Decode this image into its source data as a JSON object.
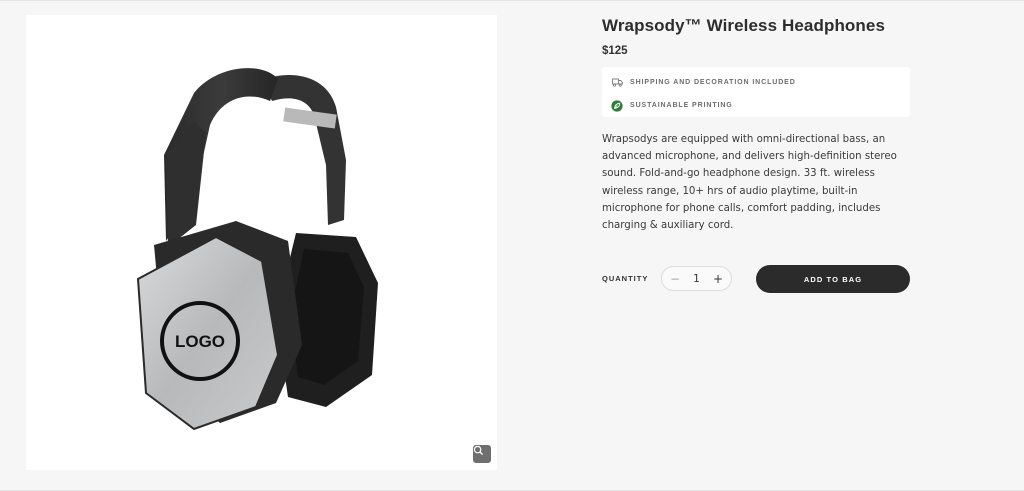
{
  "product": {
    "title": "Wrapsody™ Wireless Headphones",
    "price": "$125",
    "image_logo_text": "LOGO",
    "description": "Wrapsodys are equipped with omni-directional bass, an advanced microphone, and delivers high-definition stereo sound. Fold-and-go headphone design. 33 ft. wireless wireless range, 10+ hrs of audio playtime, built-in microphone for phone calls, comfort padding, includes charging & auxiliary cord."
  },
  "info": {
    "shipping": {
      "label": "SHIPPING AND DECORATION INCLUDED",
      "icon": "truck-icon"
    },
    "sustainable": {
      "label": "SUSTAINABLE PRINTING",
      "icon": "leaf-icon",
      "icon_color": "#2e7d3a"
    }
  },
  "purchase": {
    "quantity_label": "QUANTITY",
    "quantity_value": "1",
    "minus_symbol": "−",
    "plus_symbol": "+",
    "add_to_bag_label": "ADD TO BAG"
  },
  "icons": {
    "zoom": "zoom-icon"
  },
  "colors": {
    "button_bg": "#2b2b2b",
    "page_bg": "#f6f6f6"
  }
}
